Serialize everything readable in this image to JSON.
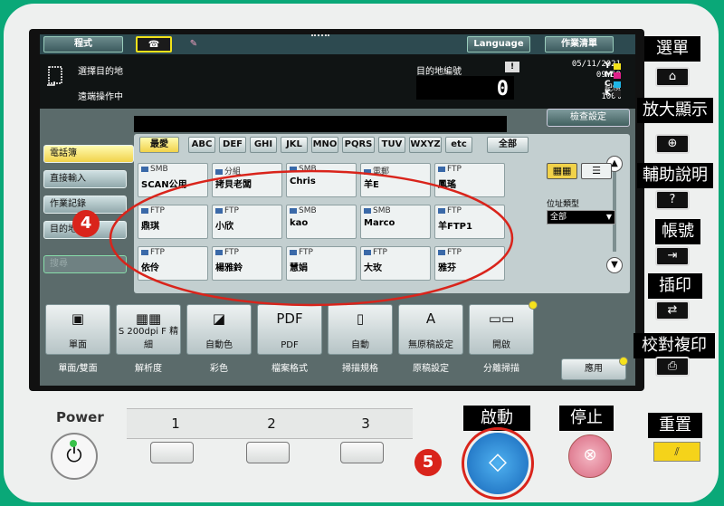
{
  "topbar": {
    "program": "程式",
    "language": "Language",
    "job_list": "作業清單"
  },
  "header": {
    "select_destination": "選擇目的地",
    "remote_operation": "遠端操作中",
    "destination_count_label": "目的地編號",
    "destination_count": "0",
    "date": "05/11/2021",
    "time": "09:59",
    "memory_label": "記憶",
    "memory_value": "100%",
    "ink_letters": [
      "Y",
      "M",
      "C",
      "K"
    ],
    "ink_colors": [
      "#f2e21a",
      "#e0208a",
      "#1fb6e6",
      "#222222"
    ]
  },
  "check_settings": "檢查設定",
  "sidebar": {
    "items": [
      {
        "label": "電話簿"
      },
      {
        "label": "直接輸入"
      },
      {
        "label": "作業記錄"
      },
      {
        "label": "目的地搜尋"
      }
    ],
    "extra": "搜尋"
  },
  "alpha_tabs": [
    "最愛",
    "ABC",
    "DEF",
    "GHI",
    "JKL",
    "MNO",
    "PQRS",
    "TUV",
    "WXYZ",
    "etc",
    "全部"
  ],
  "entries": [
    {
      "type": "SMB",
      "name": "SCAN公用"
    },
    {
      "type": "分組",
      "name": "拷貝老闆"
    },
    {
      "type": "SMB",
      "name": "Chris"
    },
    {
      "type": "電郵",
      "name": "羊E"
    },
    {
      "type": "FTP",
      "name": "鳳瑤"
    },
    {
      "type": "FTP",
      "name": "鼎琪"
    },
    {
      "type": "FTP",
      "name": "小欣"
    },
    {
      "type": "SMB",
      "name": "kao"
    },
    {
      "type": "SMB",
      "name": "Marco"
    },
    {
      "type": "FTP",
      "name": "羊FTP1"
    },
    {
      "type": "FTP",
      "name": "依伶"
    },
    {
      "type": "FTP",
      "name": "楊雅鈴"
    },
    {
      "type": "FTP",
      "name": "慧娟"
    },
    {
      "type": "FTP",
      "name": "大玫"
    },
    {
      "type": "FTP",
      "name": "雅芬"
    }
  ],
  "address_type": {
    "label": "位址類型",
    "value": "全部"
  },
  "functions": [
    {
      "label": "單面",
      "sub": "單面/雙面"
    },
    {
      "label": "S 200dpi F 精細",
      "sub": "解析度"
    },
    {
      "label": "自動色",
      "sub": "彩色"
    },
    {
      "label": "PDF",
      "sub": "檔案格式"
    },
    {
      "label": "自動",
      "sub": "掃描規格"
    },
    {
      "label": "無原稿設定",
      "sub": "原稿設定"
    },
    {
      "label": "開啟",
      "sub": "分離掃描"
    }
  ],
  "pdf_tag": "PDF",
  "apply": "應用",
  "right_labels": [
    "選單",
    "放大顯示",
    "輔助說明",
    "帳號",
    "插印",
    "校對複印"
  ],
  "physical": {
    "power": "Power",
    "presets": [
      "1",
      "2",
      "3"
    ],
    "start": "啟動",
    "stop": "停止",
    "reset": "重置"
  },
  "callouts": [
    "4",
    "5"
  ],
  "colors": {
    "start_blue": "#1e86d8",
    "stop_pink": "#e27d93",
    "reset_yellow": "#f5d31a",
    "callout_red": "#d9241b"
  }
}
